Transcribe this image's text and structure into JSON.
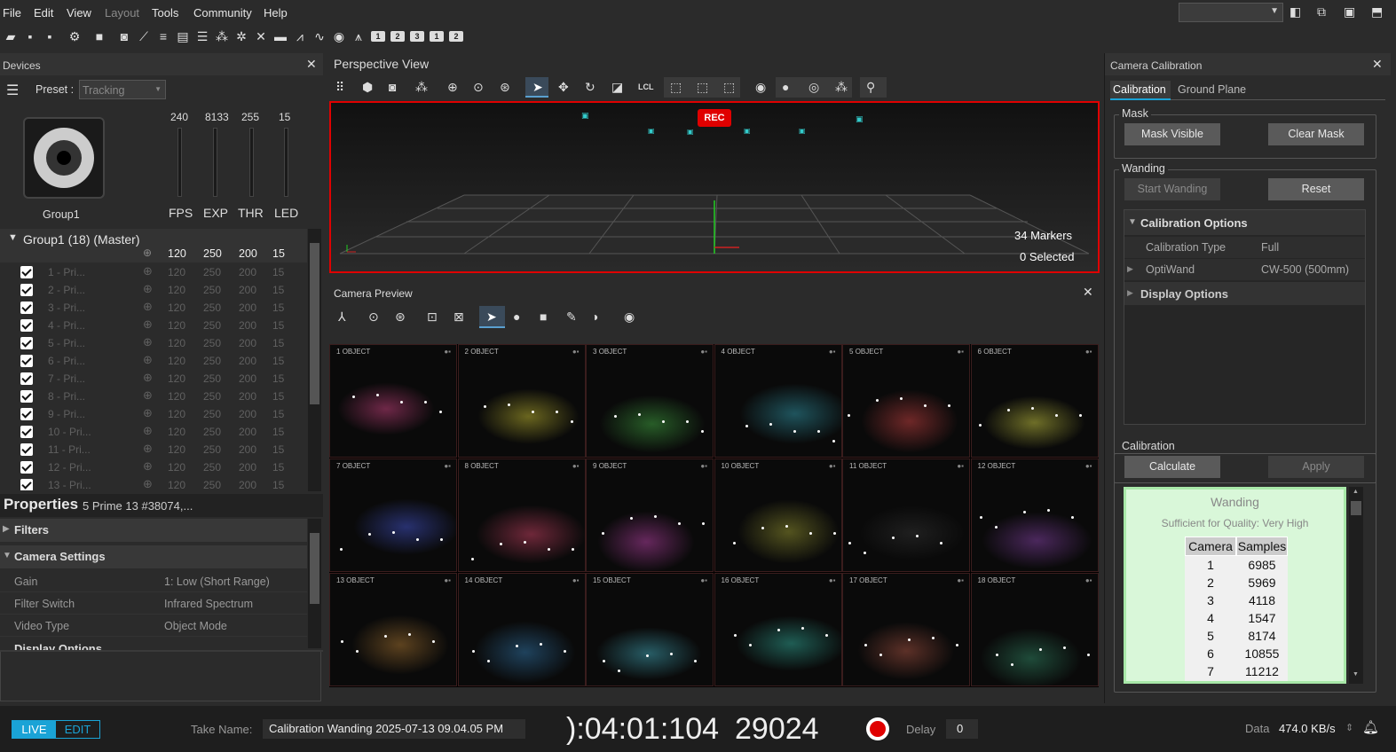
{
  "menu": [
    "File",
    "Edit",
    "View",
    "Layout",
    "Tools",
    "Community",
    "Help"
  ],
  "toolbar_numbers": [
    "1",
    "2",
    "3",
    "1",
    "2"
  ],
  "devices": {
    "title": "Devices",
    "preset_label": "Preset :",
    "preset_value": "Tracking",
    "camera_group": "Group1",
    "slider_values": [
      "240",
      "8133",
      "255",
      "15"
    ],
    "slider_labels": [
      "FPS",
      "EXP",
      "THR",
      "LED"
    ],
    "group_header": "Group1 (18) (Master)",
    "group_values": [
      "120",
      "250",
      "200",
      "15"
    ],
    "cameras": [
      {
        "name": "1 - Pri...",
        "fps": "120",
        "exp": "250",
        "thr": "200",
        "led": "15"
      },
      {
        "name": "2 - Pri...",
        "fps": "120",
        "exp": "250",
        "thr": "200",
        "led": "15"
      },
      {
        "name": "3 - Pri...",
        "fps": "120",
        "exp": "250",
        "thr": "200",
        "led": "15"
      },
      {
        "name": "4 - Pri...",
        "fps": "120",
        "exp": "250",
        "thr": "200",
        "led": "15"
      },
      {
        "name": "5 - Pri...",
        "fps": "120",
        "exp": "250",
        "thr": "200",
        "led": "15"
      },
      {
        "name": "6 - Pri...",
        "fps": "120",
        "exp": "250",
        "thr": "200",
        "led": "15"
      },
      {
        "name": "7 - Pri...",
        "fps": "120",
        "exp": "250",
        "thr": "200",
        "led": "15"
      },
      {
        "name": "8 - Pri...",
        "fps": "120",
        "exp": "250",
        "thr": "200",
        "led": "15"
      },
      {
        "name": "9 - Pri...",
        "fps": "120",
        "exp": "250",
        "thr": "200",
        "led": "15"
      },
      {
        "name": "10 - Pri...",
        "fps": "120",
        "exp": "250",
        "thr": "200",
        "led": "15"
      },
      {
        "name": "11 - Pri...",
        "fps": "120",
        "exp": "250",
        "thr": "200",
        "led": "15"
      },
      {
        "name": "12 - Pri...",
        "fps": "120",
        "exp": "250",
        "thr": "200",
        "led": "15"
      },
      {
        "name": "13 - Pri...",
        "fps": "120",
        "exp": "250",
        "thr": "200",
        "led": "15"
      }
    ]
  },
  "properties": {
    "title": "Properties",
    "subtitle": "5 Prime 13 #38074,...",
    "filters": "Filters",
    "camera_settings": "Camera Settings",
    "rows": [
      {
        "label": "Gain",
        "value": "1: Low (Short Range)"
      },
      {
        "label": "Filter Switch",
        "value": "Infrared Spectrum"
      },
      {
        "label": "Video Type",
        "value": "Object Mode"
      }
    ],
    "cut_off": "Display Options"
  },
  "perspective": {
    "title": "Perspective View",
    "rec": "REC",
    "markers": "34 Markers",
    "selected": "0 Selected",
    "lcl": "LCL"
  },
  "camera_preview": {
    "title": "Camera Preview",
    "cells": [
      {
        "num": "1",
        "mode": "OBJECT",
        "color": "#c0407a"
      },
      {
        "num": "2",
        "mode": "OBJECT",
        "color": "#b8b030"
      },
      {
        "num": "3",
        "mode": "OBJECT",
        "color": "#40a040"
      },
      {
        "num": "4",
        "mode": "OBJECT",
        "color": "#3090a0"
      },
      {
        "num": "5",
        "mode": "OBJECT",
        "color": "#c04040"
      },
      {
        "num": "6",
        "mode": "OBJECT",
        "color": "#c0c040"
      },
      {
        "num": "7",
        "mode": "OBJECT",
        "color": "#4050c0"
      },
      {
        "num": "8",
        "mode": "OBJECT",
        "color": "#c04060"
      },
      {
        "num": "9",
        "mode": "OBJECT",
        "color": "#b040a0"
      },
      {
        "num": "10",
        "mode": "OBJECT",
        "color": "#909030"
      },
      {
        "num": "11",
        "mode": "OBJECT",
        "color": "#303030"
      },
      {
        "num": "12",
        "mode": "OBJECT",
        "color": "#8040a0"
      },
      {
        "num": "13",
        "mode": "OBJECT",
        "color": "#a07030"
      },
      {
        "num": "14",
        "mode": "OBJECT",
        "color": "#3070a0"
      },
      {
        "num": "15",
        "mode": "OBJECT",
        "color": "#40a0b0"
      },
      {
        "num": "16",
        "mode": "OBJECT",
        "color": "#30a090"
      },
      {
        "num": "17",
        "mode": "OBJECT",
        "color": "#a05040"
      },
      {
        "num": "18",
        "mode": "OBJECT",
        "color": "#308060"
      }
    ]
  },
  "calibration": {
    "title": "Camera Calibration",
    "tabs": [
      "Calibration",
      "Ground Plane"
    ],
    "mask_label": "Mask",
    "mask_visible": "Mask Visible",
    "clear_mask": "Clear Mask",
    "wanding_label": "Wanding",
    "start_wanding": "Start Wanding",
    "reset": "Reset",
    "options_header": "Calibration Options",
    "calib_type_label": "Calibration Type",
    "calib_type_value": "Full",
    "optiwand_label": "OptiWand",
    "optiwand_value": "CW-500 (500mm)",
    "display_options": "Display Options",
    "calibration_label": "Calibration",
    "calculate": "Calculate",
    "apply": "Apply",
    "result_title": "Wanding",
    "result_quality": "Sufficient for Quality: Very High",
    "table_headers": [
      "Camera",
      "Samples"
    ],
    "table_rows": [
      [
        "1",
        "6985"
      ],
      [
        "2",
        "5969"
      ],
      [
        "3",
        "4118"
      ],
      [
        "4",
        "1547"
      ],
      [
        "5",
        "8174"
      ],
      [
        "6",
        "10855"
      ],
      [
        "7",
        "11212"
      ]
    ]
  },
  "status": {
    "live": "LIVE",
    "edit": "EDIT",
    "take_label": "Take Name:",
    "take_value": "Calibration Wanding 2025-07-13 09.04.05 PM",
    "timecode": "):04:01:104",
    "frame": "29024",
    "delay_label": "Delay",
    "delay_value": "0",
    "data_label": "Data",
    "data_value": "474.0 KB/s"
  },
  "colors": {
    "accent": "#1aa3d6",
    "rec": "#e00000",
    "result_bg": "#d9f7d9"
  }
}
